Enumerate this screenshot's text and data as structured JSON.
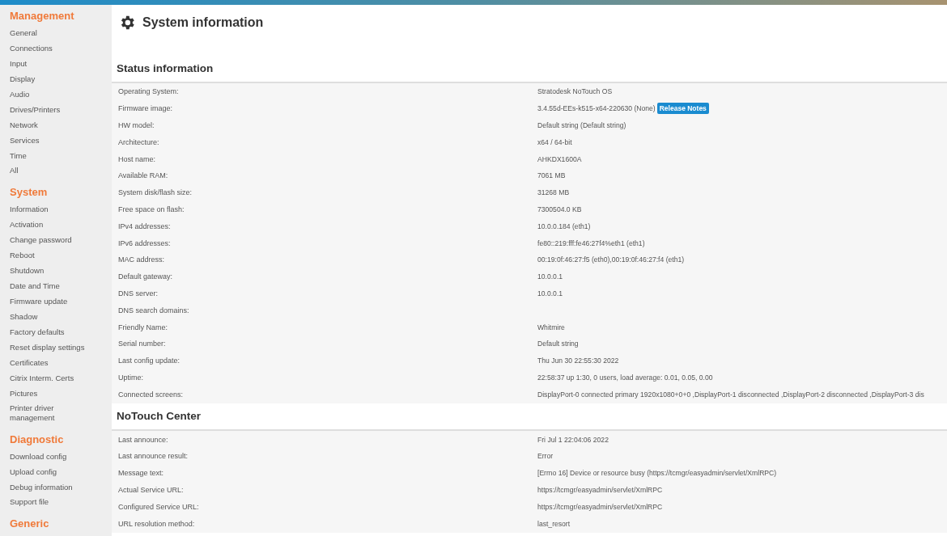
{
  "sidebar": {
    "groups": [
      {
        "heading": "Management",
        "items": [
          "General",
          "Connections",
          "Input",
          "Display",
          "Audio",
          "Drives/Printers",
          "Network",
          "Services",
          "Time",
          "All"
        ]
      },
      {
        "heading": "System",
        "items": [
          "Information",
          "Activation",
          "Change password",
          "Reboot",
          "Shutdown",
          "Date and Time",
          "Firmware update",
          "Shadow",
          "Factory defaults",
          "Reset display settings",
          "Certificates",
          "Citrix Interm. Certs",
          "Pictures",
          "Printer driver management"
        ]
      },
      {
        "heading": "Diagnostic",
        "items": [
          "Download config",
          "Upload config",
          "Debug information",
          "Support file"
        ]
      },
      {
        "heading": "Generic"
      }
    ]
  },
  "page_title": "System information",
  "sections": [
    {
      "title": "Status information",
      "rows": [
        {
          "label": "Operating System:",
          "value": "Stratodesk NoTouch OS"
        },
        {
          "label": "Firmware image:",
          "value": "3.4.55d-EEs-k515-x64-220630 (None)",
          "button": "Release Notes"
        },
        {
          "label": "HW model:",
          "value": "Default string (Default string)"
        },
        {
          "label": "Architecture:",
          "value": "x64 / 64-bit"
        },
        {
          "label": "Host name:",
          "value": "AHKDX1600A"
        },
        {
          "label": "Available RAM:",
          "value": "7061 MB"
        },
        {
          "label": "System disk/flash size:",
          "value": "31268 MB"
        },
        {
          "label": "Free space on flash:",
          "value": "7300504.0 KB"
        },
        {
          "label": "IPv4 addresses:",
          "value": "10.0.0.184 (eth1)"
        },
        {
          "label": "IPv6 addresses:",
          "value": "fe80::219:fff:fe46:27f4%eth1 (eth1)"
        },
        {
          "label": "MAC address:",
          "value": "00:19:0f:46:27:f5 (eth0),00:19:0f:46:27:f4 (eth1)"
        },
        {
          "label": "Default gateway:",
          "value": "10.0.0.1"
        },
        {
          "label": "DNS server:",
          "value": "10.0.0.1"
        },
        {
          "label": "DNS search domains:"
        },
        {
          "label": "Friendly Name:",
          "value": "Whitmire"
        },
        {
          "label": "Serial number:",
          "value": "Default string"
        },
        {
          "label": "Last config update:",
          "value": "Thu Jun 30 22:55:30 2022"
        },
        {
          "label": "Uptime:",
          "value": "22:58:37 up 1:30, 0 users, load average: 0.01, 0.05, 0.00"
        },
        {
          "label": "Connected screens:",
          "value": "DisplayPort-0 connected primary 1920x1080+0+0 ,DisplayPort-1 disconnected ,DisplayPort-2 disconnected ,DisplayPort-3 dis"
        }
      ]
    },
    {
      "title": "NoTouch Center",
      "rows": [
        {
          "label": "Last announce:",
          "value": "Fri Jul 1 22:04:06 2022"
        },
        {
          "label": "Last announce result:",
          "value": "Error"
        },
        {
          "label": "Message text:",
          "value": "[Errno 16] Device or resource busy (https://tcmgr/easyadmin/servlet/XmlRPC)"
        },
        {
          "label": "Actual Service URL:",
          "value": "https://tcmgr/easyadmin/servlet/XmlRPC"
        },
        {
          "label": "Configured Service URL:",
          "value": "https://tcmgr/easyadmin/servlet/XmlRPC"
        },
        {
          "label": "URL resolution method:",
          "value": "last_resort"
        }
      ]
    }
  ]
}
